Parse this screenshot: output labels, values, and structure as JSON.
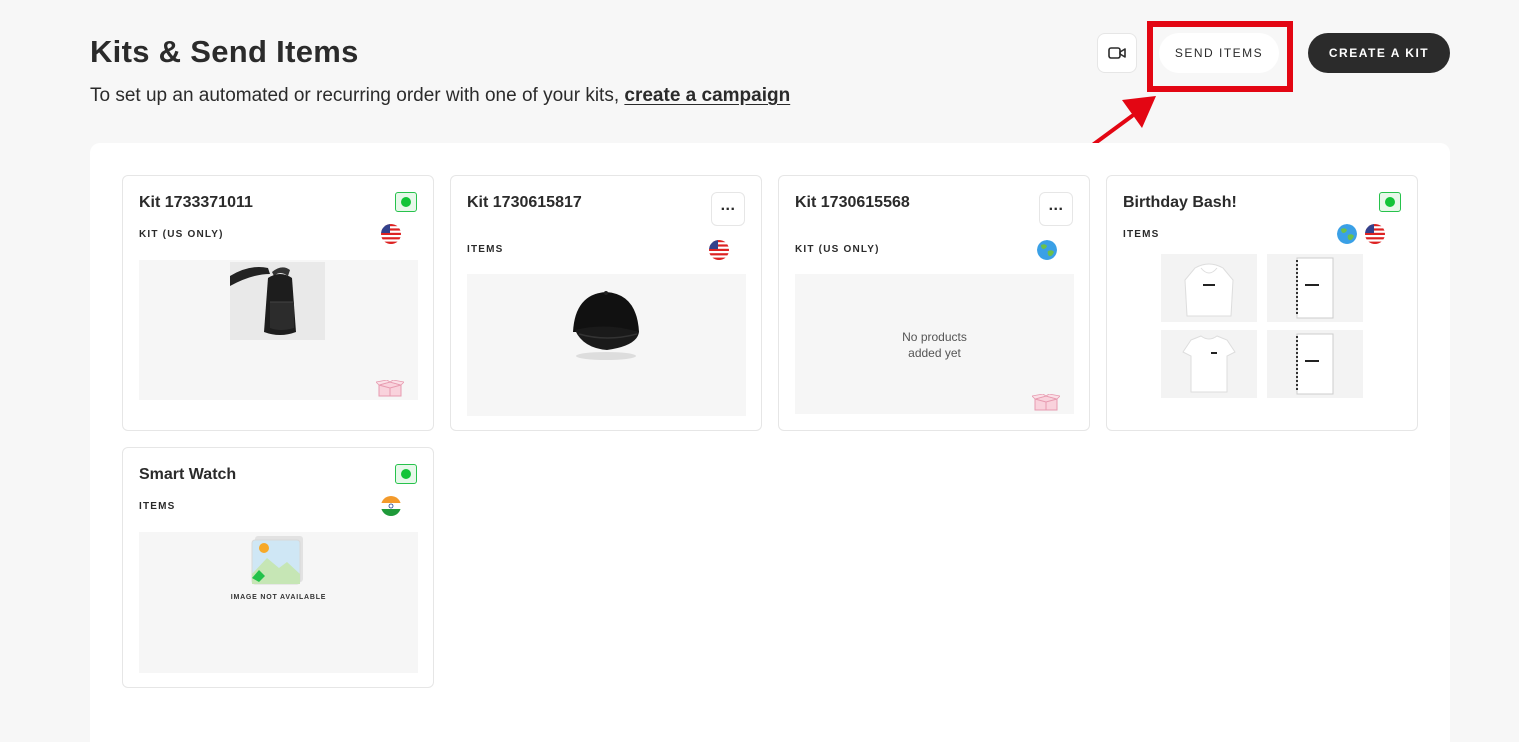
{
  "header": {
    "title": "Kits & Send Items",
    "subtitle": "To set up an automated or recurring order with one of your kits,",
    "subtitle_link": "create a campaign",
    "video_icon": "video-camera-icon",
    "send_items_label": "SEND ITEMS",
    "create_kit_label": "CREATE A KIT"
  },
  "colors": {
    "accent_dark": "#2b2b2b",
    "annotation_red": "#e30613",
    "status_green": "#12c438"
  },
  "kits": [
    {
      "name": "Kit 1733371011",
      "type": "KIT (US ONLY)",
      "control": "status-active",
      "flags": [
        "us-flag"
      ],
      "preview": "backpack-image",
      "badge": "box-icon"
    },
    {
      "name": "Kit 1730615817",
      "type": "ITEMS",
      "control": "more-menu",
      "menu_label": "...",
      "flags": [
        "us-flag"
      ],
      "preview": "black-cap-image"
    },
    {
      "name": "Kit 1730615568",
      "type": "KIT (US ONLY)",
      "control": "more-menu",
      "menu_label": "...",
      "flags": [
        "globe-icon"
      ],
      "preview_text": "No products added yet",
      "badge": "box-icon"
    },
    {
      "name": "Birthday Bash!",
      "type": "ITEMS",
      "control": "status-active",
      "flags": [
        "globe-icon",
        "us-flag"
      ],
      "preview": "product-grid"
    },
    {
      "name": "Smart Watch",
      "type": "ITEMS",
      "control": "status-active",
      "flags": [
        "india-flag"
      ],
      "preview": "image-placeholder-icon",
      "preview_text": "IMAGE NOT AVAILABLE"
    }
  ]
}
